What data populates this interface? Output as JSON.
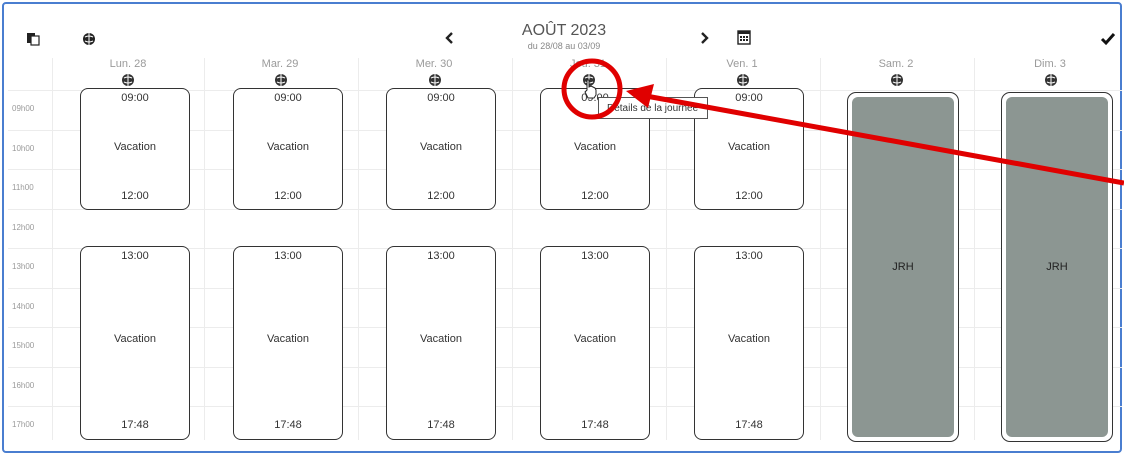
{
  "header": {
    "month": "AOÛT 2023",
    "range": "du 28/08 au 03/09"
  },
  "days": [
    {
      "label": "Lun. 28"
    },
    {
      "label": "Mar. 29"
    },
    {
      "label": "Mer. 30"
    },
    {
      "label": "Jeu. 31"
    },
    {
      "label": "Ven. 1"
    },
    {
      "label": "Sam. 2"
    },
    {
      "label": "Dim. 3"
    }
  ],
  "hours": [
    "09h00",
    "10h00",
    "11h00",
    "12h00",
    "13h00",
    "14h00",
    "15h00",
    "16h00",
    "17h00"
  ],
  "morning": {
    "start": "09:00",
    "label": "Vacation",
    "end": "12:00"
  },
  "afternoon": {
    "start": "13:00",
    "label": "Vacation",
    "end": "17:48"
  },
  "rest_label": "JRH",
  "tooltip": "Détails de la journée",
  "colors": {
    "accent": "#4a7ed0",
    "rest_fill": "#8c9692",
    "annotation": "#e00000"
  },
  "icons": [
    "copy-icon",
    "globe-icon",
    "chevron-left-icon",
    "chevron-right-icon",
    "calendar-icon",
    "checkmark-icon",
    "cursor-icon"
  ]
}
